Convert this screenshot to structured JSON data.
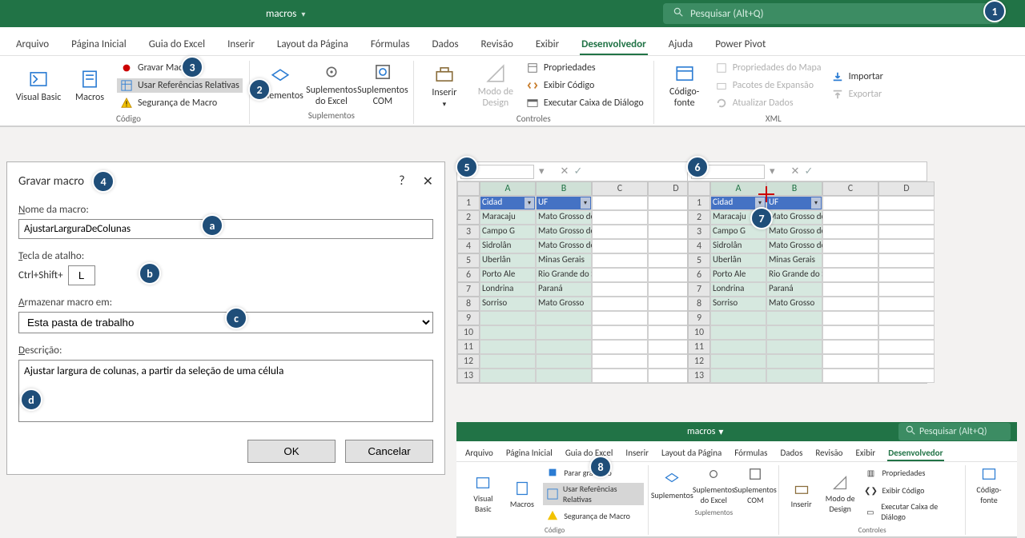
{
  "titlebar": {
    "workbook": "macros"
  },
  "search": {
    "placeholder": "Pesquisar (Alt+Q)"
  },
  "tabs": {
    "arquivo": "Arquivo",
    "pagina_inicial": "Página Inicial",
    "guia_excel": "Guia do Excel",
    "inserir": "Inserir",
    "layout": "Layout da Página",
    "formulas": "Fórmulas",
    "dados": "Dados",
    "revisao": "Revisão",
    "exibir": "Exibir",
    "desenvolvedor": "Desenvolvedor",
    "ajuda": "Ajuda",
    "power_pivot": "Power Pivot"
  },
  "ribbon": {
    "codigo": {
      "label": "Código",
      "visual_basic": "Visual Basic",
      "macros": "Macros",
      "gravar_macro": "Gravar Macro",
      "usar_ref": "Usar Referências Relativas",
      "seguranca": "Segurança de Macro",
      "parar_grav": "Parar gravação"
    },
    "suplementos": {
      "label": "Suplementos",
      "suplementos": "uplementos",
      "suplementos_full": "Suplementos",
      "do_excel": "Suplementos do Excel",
      "com": "Suplementos COM"
    },
    "controles": {
      "label": "Controles",
      "inserir": "Inserir",
      "modo_design": "Modo de Design",
      "propriedades": "Propriedades",
      "exibir_codigo": "Exibir Código",
      "executar": "Executar Caixa de Diálogo"
    },
    "xml": {
      "label": "XML",
      "codigo_fonte": "Código-fonte",
      "prop_mapa": "Propriedades do Mapa",
      "pacotes": "Pacotes de Expansão",
      "atualizar": "Atualizar Dados",
      "importar": "Importar",
      "exportar": "Exportar"
    }
  },
  "dialog": {
    "title": "Gravar macro",
    "nome_label": "Nome da macro:",
    "nome_value": "AjustarLarguraDeColunas",
    "tecla_label": "Tecla de atalho:",
    "tecla_prefix": "Ctrl+Shift+",
    "tecla_value": "L",
    "armazenar_label": "Armazenar macro em:",
    "armazenar_value": "Esta pasta de trabalho",
    "descricao_label": "Descrição:",
    "descricao_value": "Ajustar largura de colunas, a partir da seleção de uma célula",
    "ok": "OK",
    "cancelar": "Cancelar"
  },
  "sheet": {
    "cols": [
      "A",
      "B",
      "C",
      "D"
    ],
    "header": {
      "a": "Cidad",
      "b": "UF"
    },
    "rows": [
      {
        "a": "Maracaju",
        "b": "Mato Grosso do Sul"
      },
      {
        "a": "Campo G",
        "b": "Mato Grosso do Sul"
      },
      {
        "a": "Sidrolân",
        "b": "Mato Grosso do Sul"
      },
      {
        "a": "Uberlân",
        "b": "Minas Gerais"
      },
      {
        "a": "Porto Ale",
        "b": "Rio Grande do Sul"
      },
      {
        "a": "Londrina",
        "b": "Paraná"
      },
      {
        "a": "Sorriso",
        "b": "Mato Grosso"
      }
    ]
  },
  "callouts": {
    "c1": "1",
    "c2": "2",
    "c3": "3",
    "c4": "4",
    "c5": "5",
    "c6": "6",
    "c7": "7",
    "c8": "8",
    "ca": "a",
    "cb": "b",
    "cc": "c",
    "cd": "d"
  }
}
